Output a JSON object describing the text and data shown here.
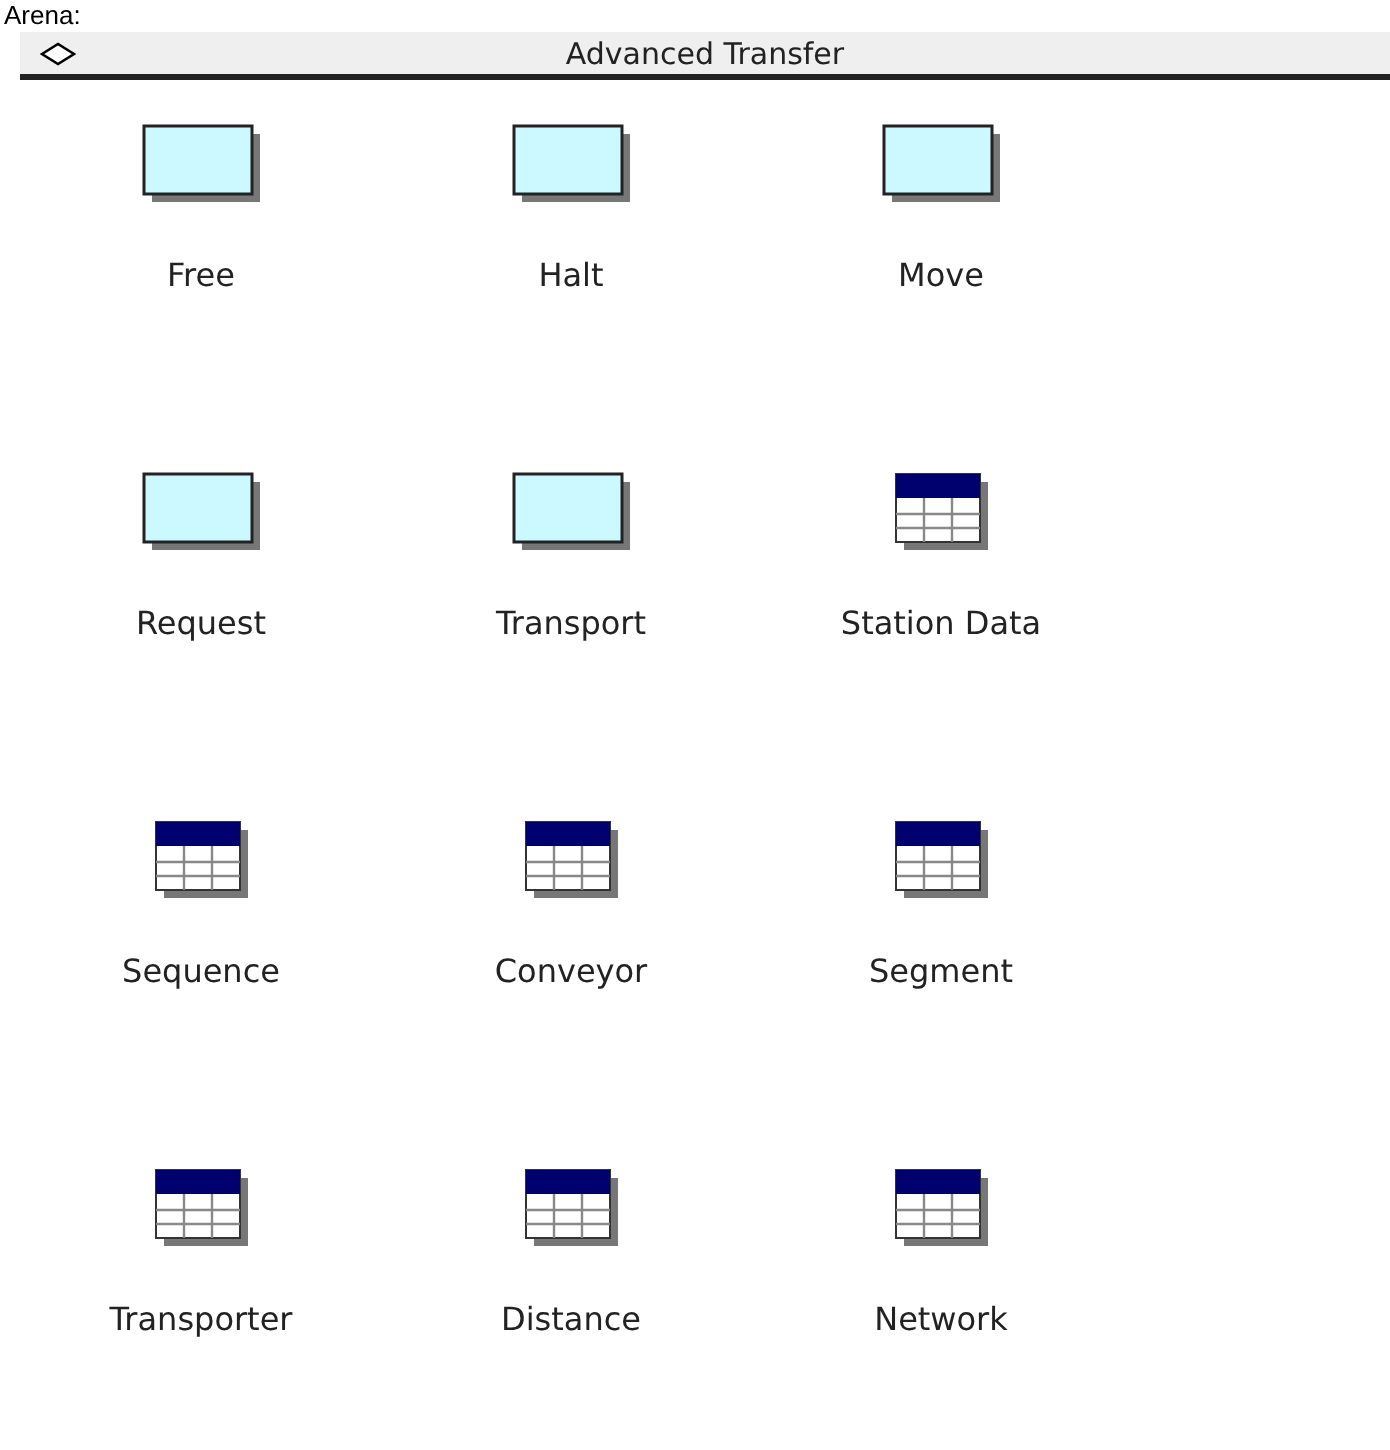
{
  "caption": "Arena:",
  "panel": {
    "title": "Advanced Transfer"
  },
  "modules": [
    {
      "label": "Free",
      "kind": "logic"
    },
    {
      "label": "Halt",
      "kind": "logic"
    },
    {
      "label": "Move",
      "kind": "logic"
    },
    {
      "label": "Request",
      "kind": "logic"
    },
    {
      "label": "Transport",
      "kind": "logic"
    },
    {
      "label": "Station Data",
      "kind": "data"
    },
    {
      "label": "Sequence",
      "kind": "data"
    },
    {
      "label": "Conveyor",
      "kind": "data"
    },
    {
      "label": "Segment",
      "kind": "data"
    },
    {
      "label": "Transporter",
      "kind": "data"
    },
    {
      "label": "Distance",
      "kind": "data"
    },
    {
      "label": "Network",
      "kind": "data"
    }
  ]
}
